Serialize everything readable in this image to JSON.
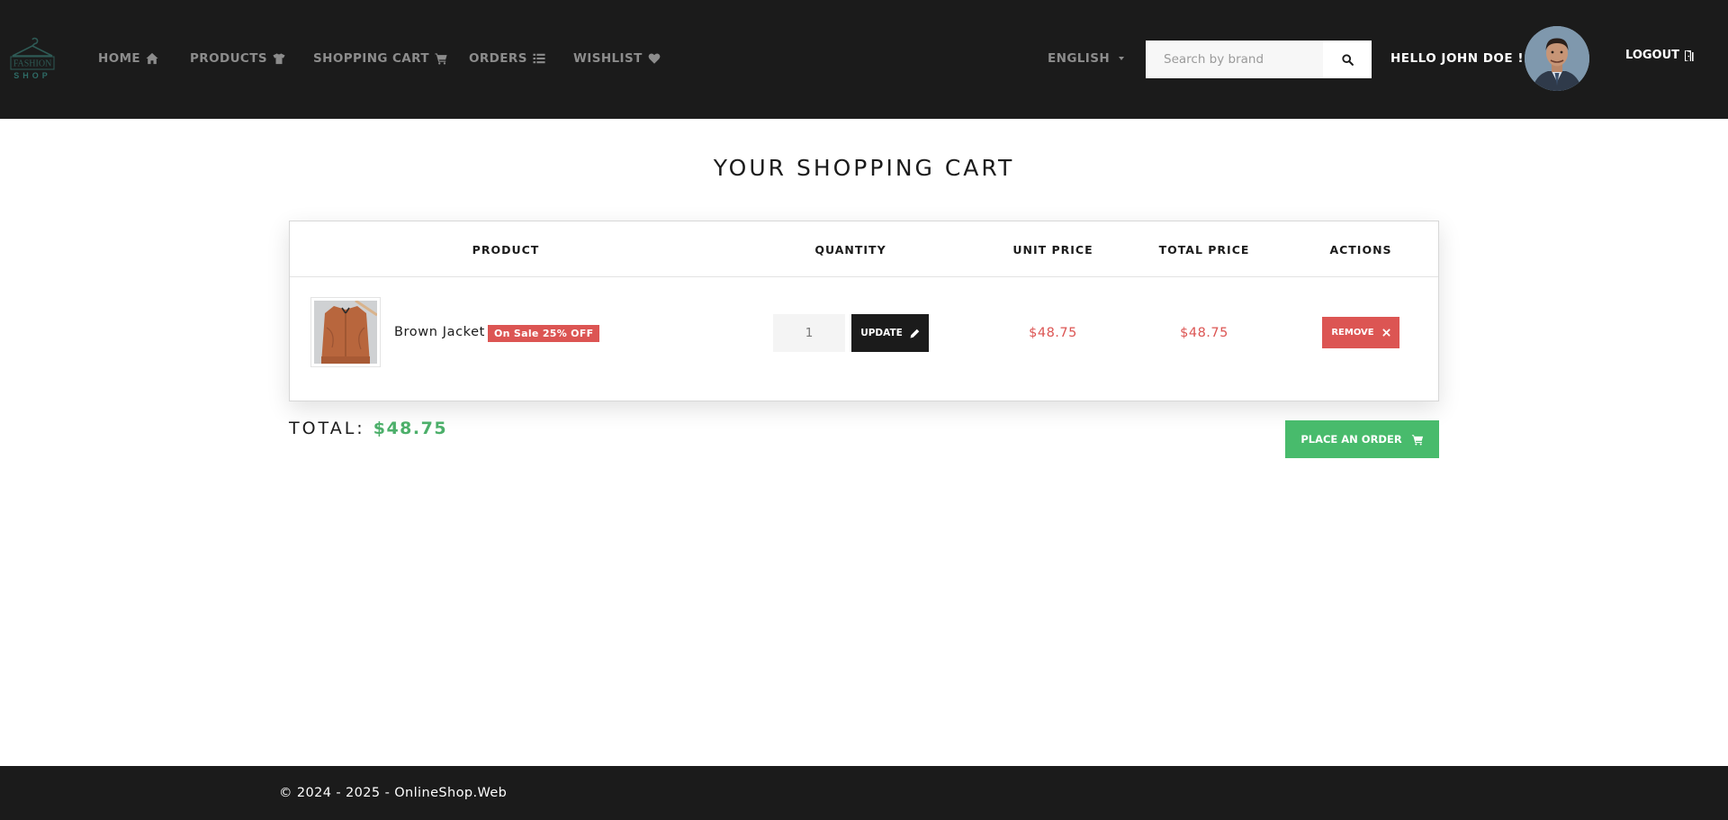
{
  "header": {
    "logo": {
      "brand_top": "FASHION",
      "brand_bottom": "SHOP"
    },
    "nav": [
      {
        "label": "HOME",
        "icon": "home-icon"
      },
      {
        "label": "PRODUCTS",
        "icon": "tshirt-icon"
      },
      {
        "label": "SHOPPING CART",
        "icon": "cart-icon"
      },
      {
        "label": "ORDERS",
        "icon": "list-icon"
      },
      {
        "label": "WISHLIST",
        "icon": "heart-icon"
      }
    ],
    "language": "ENGLISH",
    "search": {
      "placeholder": "Search by brand",
      "value": "",
      "icon": "search-icon"
    },
    "greeting": "HELLO JOHN DOE !",
    "logout_label": "LOGOUT",
    "logout_icon": "door-icon"
  },
  "main": {
    "title": "YOUR SHOPPING CART",
    "table": {
      "columns": [
        "PRODUCT",
        "QUANTITY",
        "UNIT PRICE",
        "TOTAL PRICE",
        "ACTIONS"
      ],
      "rows": [
        {
          "product_name": "Brown Jacket",
          "badge": "On Sale 25% OFF",
          "quantity": "1",
          "update_label": "UPDATE",
          "unit_price": "$48.75",
          "total_price": "$48.75",
          "remove_label": "REMOVE"
        }
      ]
    },
    "total_label": "TOTAL:",
    "total_value": "$48.75",
    "order_button": "PLACE AN ORDER"
  },
  "footer": {
    "text": "© 2024 - 2025 - OnlineShop.Web"
  },
  "colors": {
    "navbar": "#1b1b1b",
    "nav_text": "#8c8c8c",
    "danger": "#dc5553",
    "success": "#48bb6c",
    "total_value": "#4caf6a"
  }
}
